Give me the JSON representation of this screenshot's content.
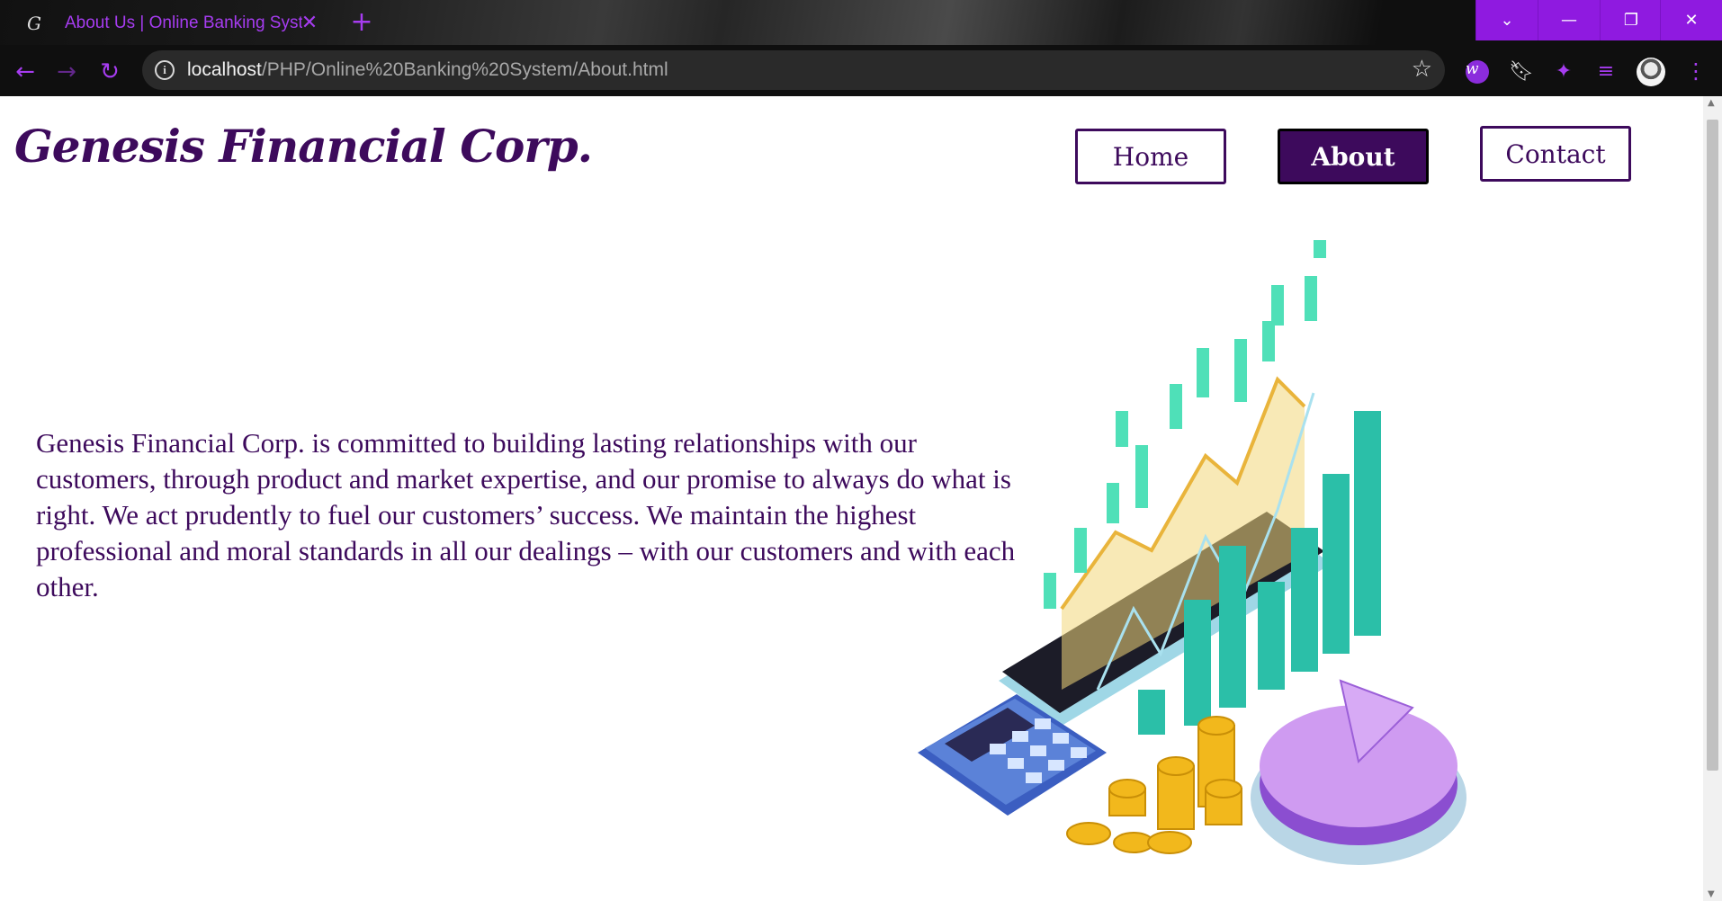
{
  "browser": {
    "tab_title": "About Us | Online Banking System",
    "url_host": "localhost",
    "url_path": "/PHP/Online%20Banking%20System/About.html",
    "accent_color": "#a63cf0",
    "icons": [
      "g-favicon-icon",
      "close-icon",
      "plus-icon",
      "chevron-down-icon",
      "minimize-icon",
      "restore-icon",
      "close-window-icon",
      "back-arrow-icon",
      "forward-arrow-icon",
      "reload-icon",
      "info-icon",
      "star-icon",
      "extension-w-icon",
      "bookmark-icon",
      "puzzle-icon",
      "reading-list-icon",
      "avatar",
      "more-menu-icon"
    ]
  },
  "site": {
    "brand": "Genesis Financial Corp.",
    "brand_color": "#3d0a5c",
    "nav": [
      {
        "label": "Home",
        "active": false
      },
      {
        "label": "About",
        "active": true
      },
      {
        "label": "Contact",
        "active": false
      }
    ],
    "about_text": "Genesis Financial Corp. is committed to building lasting relationships with our customers, through product and market expertise, and our promise to always do what is right. We act prudently to fuel our customers’ success. We maintain the highest professional and moral standards in all our dealings – with our customers and with each other."
  }
}
